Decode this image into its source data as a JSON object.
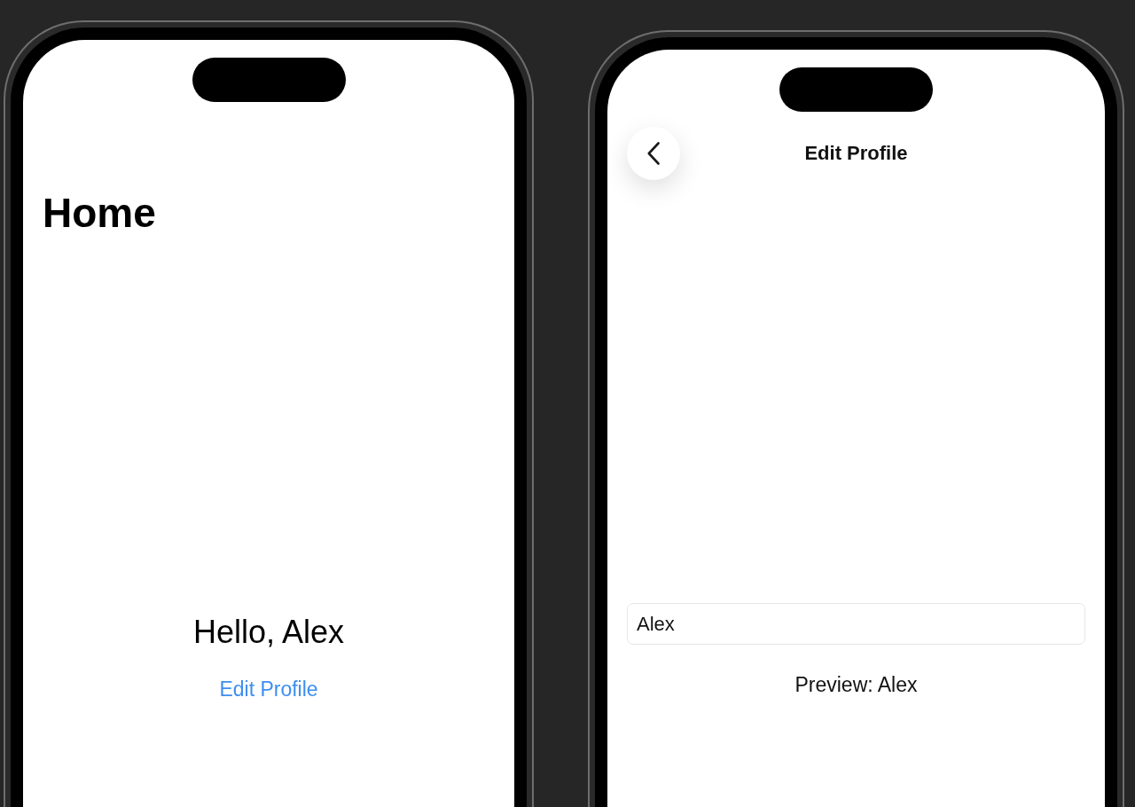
{
  "screens": [
    {
      "kind": "home",
      "large_title": "Home",
      "greeting": "Hello, Alex",
      "link": "Edit Profile"
    },
    {
      "kind": "edit",
      "nav_title": "Edit Profile",
      "name_field": {
        "value": "Alex"
      },
      "preview": "Preview: Alex"
    }
  ]
}
